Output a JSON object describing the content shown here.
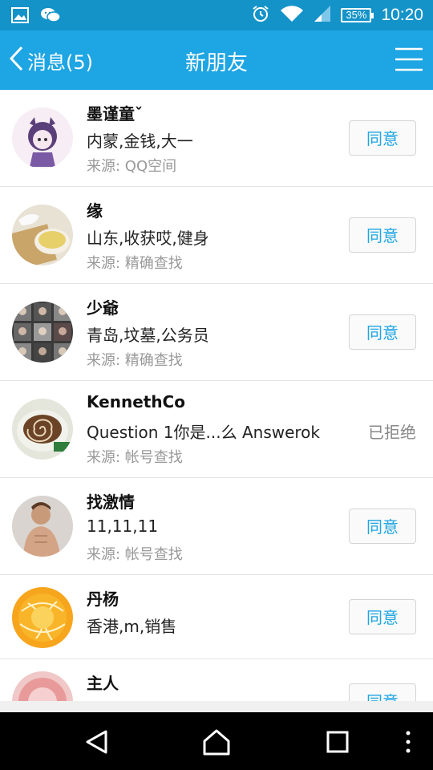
{
  "status_bar": {
    "time": "10:20",
    "battery": "35%",
    "icons": [
      "gallery-icon",
      "wechat-icon",
      "alarm-icon",
      "wifi-icon",
      "signal-icon",
      "battery-icon"
    ]
  },
  "header": {
    "back_label": "消息(5)",
    "title": "新朋友"
  },
  "requests": [
    {
      "name": "墨谨童ˇ",
      "desc": "内蒙,金钱,大一",
      "source": "来源: QQ空间",
      "action": "同意"
    },
    {
      "name": "缘",
      "desc": "山东,收获哎,健身",
      "source": "来源: 精确查找",
      "action": "同意"
    },
    {
      "name": "少爺",
      "desc": "青岛,坟墓,公务员",
      "source": "来源: 精确查找",
      "action": "同意"
    },
    {
      "name": "KennethCo",
      "desc": "Question 1你是...么 Answerok",
      "source": "来源: 帐号查找",
      "status": "已拒绝"
    },
    {
      "name": "找激情",
      "desc": "11,11,11",
      "source": "来源: 帐号查找",
      "action": "同意"
    },
    {
      "name": "丹杨",
      "desc": "香港,m,销售",
      "action": "同意"
    },
    {
      "name": "主人",
      "action": "同意"
    }
  ],
  "colors": {
    "status_bar": "#1493c9",
    "title_bar": "#1ea5e3",
    "accent": "#1ea5e3"
  }
}
